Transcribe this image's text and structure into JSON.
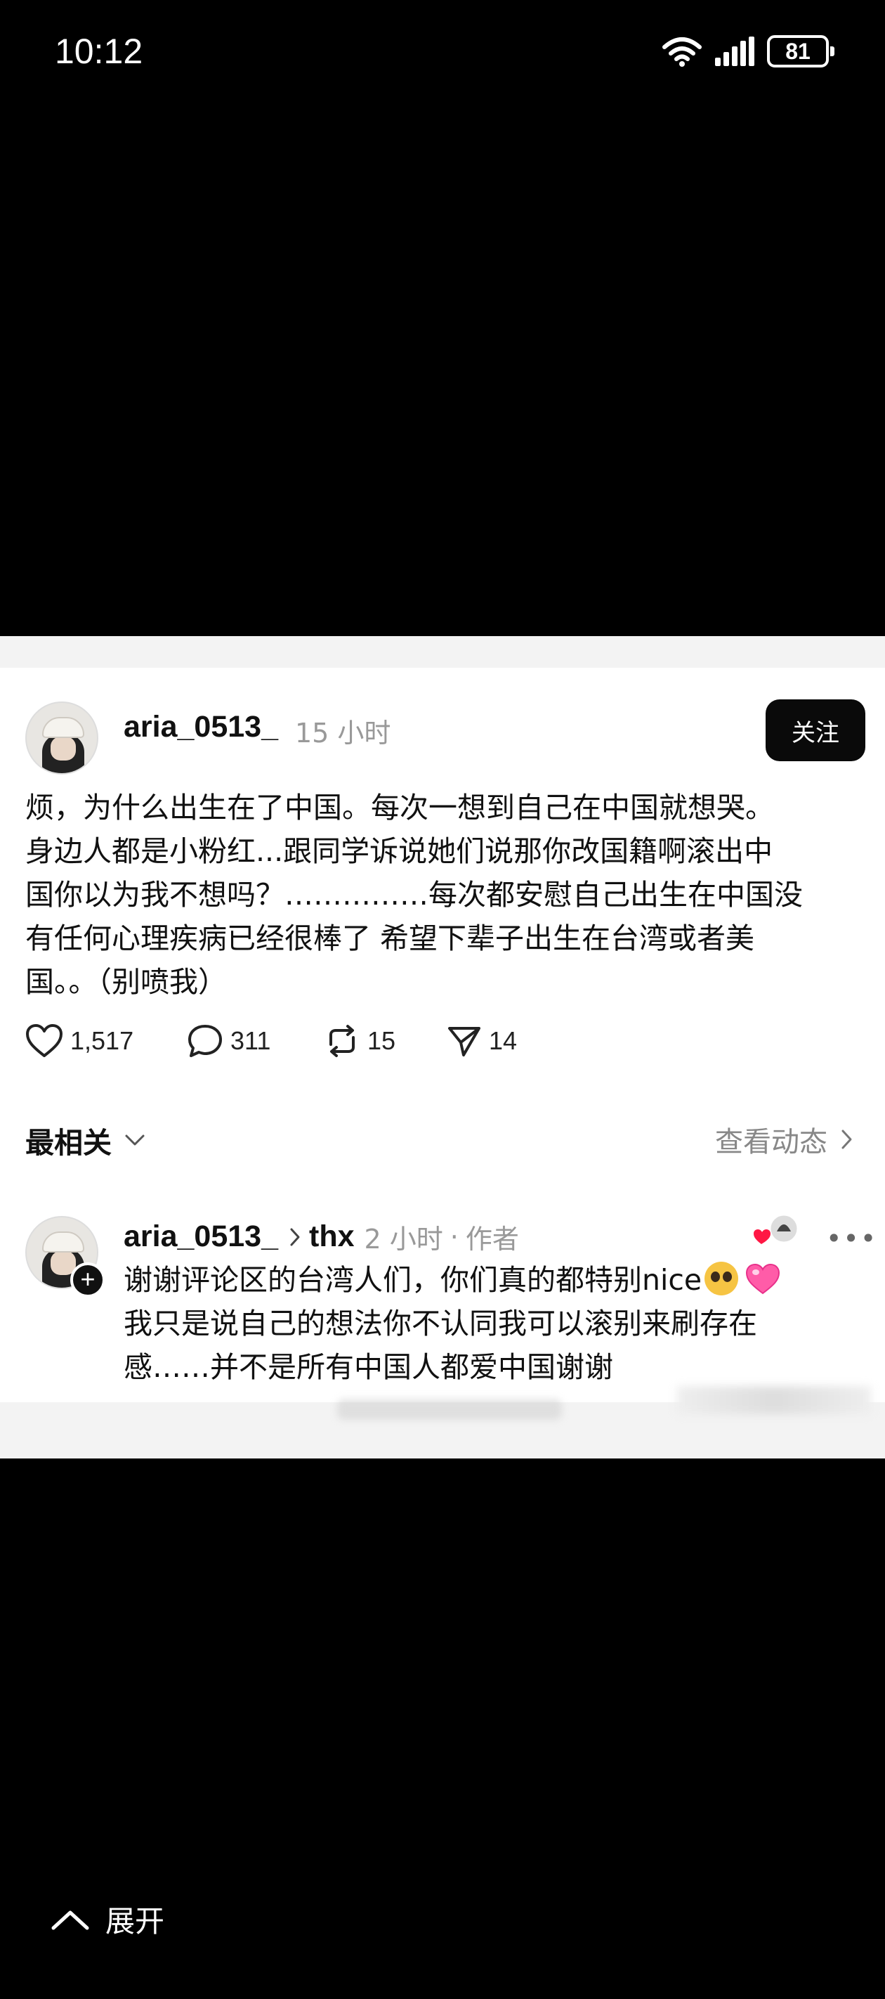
{
  "status_bar": {
    "time": "10:12",
    "battery": "81",
    "icons": [
      "wifi-icon",
      "signal-icon",
      "battery-icon"
    ]
  },
  "post": {
    "username": "aria_0513_",
    "time": "15 小时",
    "follow_label": "关注",
    "lines": [
      "烦，为什么出生在了中国。每次一想到自己在中国就想哭。",
      "身边人都是小粉红...跟同学诉说她们说那你改国籍啊滚出中",
      "国你以为我不想吗？……………每次都安慰自己出生在中国没",
      "有任何心理疾病已经很棒了 希望下辈子出生在台湾或者美",
      "国。。（别喷我）"
    ],
    "stats": {
      "likes": "1,517",
      "comments": "311",
      "reposts": "15",
      "shares": "14"
    }
  },
  "comments_header": {
    "sort_label": "最相关",
    "activity_label": "查看动态"
  },
  "reply": {
    "username": "aria_0513_",
    "reply_to": "thx",
    "time": "2 小时",
    "separator": "·",
    "role": "作者",
    "more": "•••",
    "line1": "谢谢评论区的台湾人们，你们真的都特别nice",
    "line2": "我只是说自己的想法你不认同我可以滚别来刷存在",
    "line3": "感……并不是所有中国人都爱中国谢谢"
  },
  "footer": {
    "expand_label": "展开"
  },
  "colors": {
    "background": "#000000",
    "card": "#ffffff",
    "follow_button": "#0a0a0a",
    "muted_text": "#999999",
    "heart_emoji": "#ff5ca8"
  }
}
